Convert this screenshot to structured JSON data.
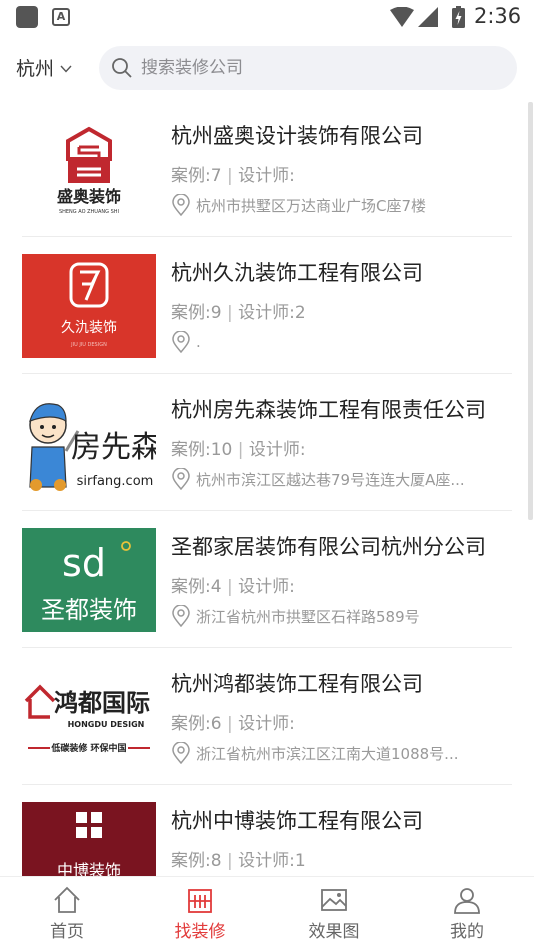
{
  "status_bar": {
    "a_icon_label": "A",
    "time": "2:36"
  },
  "header": {
    "city": "杭州",
    "search_placeholder": "搜索装修公司"
  },
  "logos": {
    "shengao": {
      "sub": "盛奥装饰",
      "pinyin": "SHENG AO ZHUANG SHI"
    },
    "jiujiu": {
      "sub": "久氿装饰",
      "pinyin": "JIU JIU DESIGN"
    },
    "sirfang": {
      "big": "房先森",
      "domain": "sirfang.com"
    },
    "shengdu": {
      "mark": "sd",
      "sub": "圣都装饰"
    },
    "hongdu": {
      "big": "鸿都国际",
      "en": "HONGDU DESIGN",
      "slogan": "低碳装修 环保中国"
    },
    "zhongbo": {
      "sub": "中博装饰"
    }
  },
  "companies": [
    {
      "name": "杭州盛奥设计装饰有限公司",
      "cases": "案例:7",
      "designers": "设计师:",
      "address": "杭州市拱墅区万达商业广场C座7楼"
    },
    {
      "name": "杭州久氿装饰工程有限公司",
      "cases": "案例:9",
      "designers": "设计师:2",
      "address": "."
    },
    {
      "name": "杭州房先森装饰工程有限责任公司",
      "cases": "案例:10",
      "designers": "设计师:",
      "address": "杭州市滨江区越达巷79号连连大厦A座..."
    },
    {
      "name": "圣都家居装饰有限公司杭州分公司",
      "cases": "案例:4",
      "designers": "设计师:",
      "address": "浙江省杭州市拱墅区石祥路589号"
    },
    {
      "name": "杭州鸿都装饰工程有限公司",
      "cases": "案例:6",
      "designers": "设计师:",
      "address": "浙江省杭州市滨江区江南大道1088号..."
    },
    {
      "name": "杭州中博装饰工程有限公司",
      "cases": "案例:8",
      "designers": "设计师:1",
      "address": ""
    }
  ],
  "nav": {
    "home": "首页",
    "find": "找装修",
    "effects": "效果图",
    "mine": "我的"
  },
  "colors": {
    "accent": "#e23b3b",
    "jiujiu_bg": "#d8352a",
    "shengdu_bg": "#2e8a5e",
    "zhongbo_bg": "#7a1420",
    "shengao_red": "#c0282f"
  },
  "icons": [
    "app-square-icon",
    "a-icon",
    "wifi-icon",
    "signal-icon",
    "battery-icon",
    "chevron-down-icon",
    "search-icon",
    "location-pin-icon",
    "home-icon",
    "building-icon",
    "image-icon",
    "user-icon"
  ]
}
